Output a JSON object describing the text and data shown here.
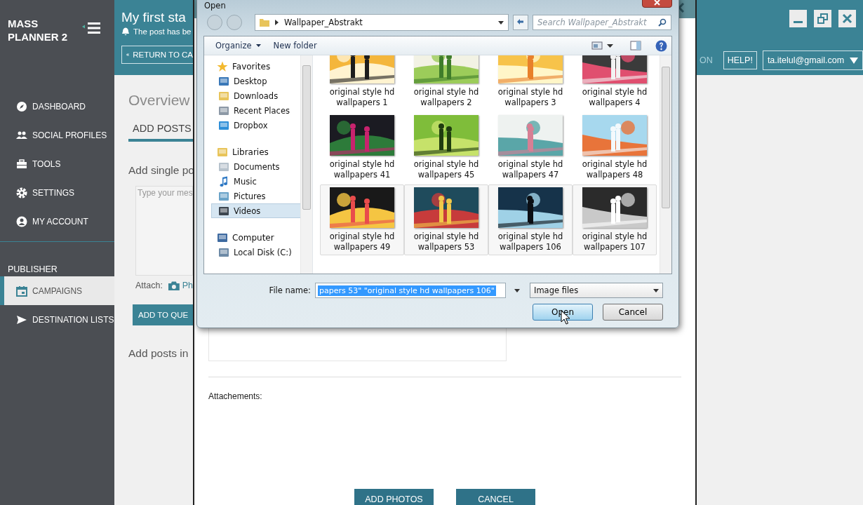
{
  "sidebar": {
    "logo": "MASS PLANNER 2",
    "items": [
      {
        "label": "DASHBOARD",
        "selected": false
      },
      {
        "label": "SOCIAL PROFILES",
        "selected": false
      },
      {
        "label": "TOOLS",
        "selected": false
      },
      {
        "label": "SETTINGS",
        "selected": false
      },
      {
        "label": "MY ACCOUNT",
        "selected": false
      }
    ],
    "sections": [
      {
        "title": "PUBLISHER",
        "items": [
          {
            "label": "CAMPAIGNS",
            "selected": true
          },
          {
            "label": "DESTINATION LISTS",
            "selected": false
          }
        ]
      }
    ]
  },
  "page": {
    "title": "My first sta",
    "notice": "The post has be",
    "back_button": "RETURN TO CA",
    "heading": "Overview",
    "tabs": [
      {
        "label": "ADD POSTS",
        "selected": true
      }
    ],
    "single_post_label": "Add single po",
    "message_placeholder": "Type your mes",
    "attach_label": "Attach:",
    "attach_option": "Ph",
    "add_button": "ADD TO QUE",
    "bulk_label": "Add posts in"
  },
  "topbar": {
    "cut_label": "ON",
    "help_button": "HELP!",
    "account": "ta.itelul@gmail.com"
  },
  "modal": {
    "attachments_label": "Attachements:",
    "buttons": [
      "ADD PHOTOS",
      "CANCEL"
    ]
  },
  "open_dialog": {
    "title": "Open",
    "path": "Wallpaper_Abstrakt",
    "search_placeholder": "Search Wallpaper_Abstrakt",
    "toolbar": [
      "Organize",
      "New folder"
    ],
    "nav": [
      {
        "label": "Favorites",
        "selected": false,
        "children": [
          {
            "label": "Desktop",
            "selected": false
          },
          {
            "label": "Downloads",
            "selected": false
          },
          {
            "label": "Recent Places",
            "selected": false
          },
          {
            "label": "Dropbox",
            "selected": false
          }
        ]
      },
      {
        "label": "Libraries",
        "selected": false,
        "children": [
          {
            "label": "Documents",
            "selected": false
          },
          {
            "label": "Music",
            "selected": false
          },
          {
            "label": "Pictures",
            "selected": false
          },
          {
            "label": "Videos",
            "selected": true
          }
        ]
      },
      {
        "label": "Computer",
        "selected": false,
        "children": [
          {
            "label": "Local Disk (C:)",
            "selected": false
          }
        ]
      }
    ],
    "files": [
      {
        "name": "original style hd wallpapers 1",
        "selected": false
      },
      {
        "name": "original style hd wallpapers 2",
        "selected": false
      },
      {
        "name": "original style hd wallpapers 3",
        "selected": false
      },
      {
        "name": "original style hd wallpapers 4",
        "selected": false
      },
      {
        "name": "original style hd wallpapers 41",
        "selected": false
      },
      {
        "name": "original style hd wallpapers 45",
        "selected": false
      },
      {
        "name": "original style hd wallpapers 47",
        "selected": false
      },
      {
        "name": "original style hd wallpapers 48",
        "selected": false
      },
      {
        "name": "original style hd wallpapers 49",
        "selected": true
      },
      {
        "name": "original style hd wallpapers 53",
        "selected": true
      },
      {
        "name": "original style hd wallpapers 106",
        "selected": true
      },
      {
        "name": "original style hd wallpapers 107",
        "selected": true
      }
    ],
    "file_name_label": "File name:",
    "file_name": "papers 53\" \"original style hd wallpapers 106\"",
    "file_type": "Image files",
    "buttons": [
      "Open",
      "Cancel"
    ]
  }
}
